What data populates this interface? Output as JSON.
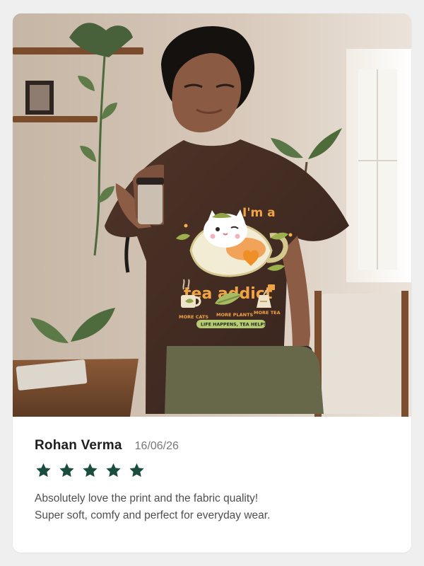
{
  "review": {
    "reviewer_name": "Rohan Verma",
    "date": "16/06/26",
    "rating": 5,
    "text_lines": [
      "Absolutely love the print and the fabric quality!",
      "Super soft, comfy and perfect for everyday wear."
    ],
    "star_color": "#1b4d3e"
  },
  "photo": {
    "shirt_print": {
      "headline_top": "I'm a",
      "headline_bottom": "tea addict",
      "labels": [
        "MORE CATS",
        "MORE PLANTS",
        "MORE TEA"
      ],
      "tagline": "LIFE HAPPENS, TEA HELPS"
    },
    "icons": [
      "cat-in-cup-icon",
      "leaf-icon",
      "tea-bag-icon",
      "coffee-cup-icon"
    ]
  }
}
